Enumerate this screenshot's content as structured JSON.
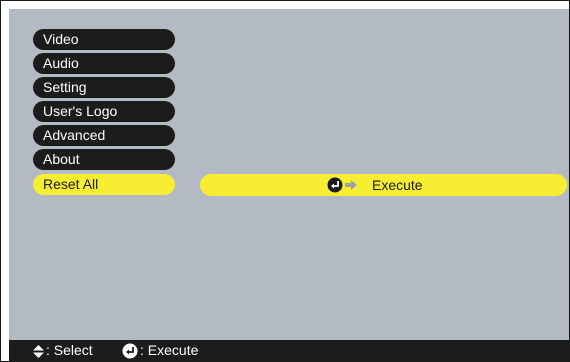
{
  "menu": {
    "items": [
      {
        "label": "Video"
      },
      {
        "label": "Audio"
      },
      {
        "label": "Setting"
      },
      {
        "label": "User's Logo"
      },
      {
        "label": "Advanced"
      },
      {
        "label": "About"
      },
      {
        "label": "Reset All",
        "selected": true
      }
    ]
  },
  "submenu": {
    "execute_label": "Execute",
    "icons": [
      "enter-icon",
      "arrow-right-icon"
    ]
  },
  "status_bar": {
    "select_label": ": Select",
    "execute_label": ": Execute",
    "icons": [
      "up-down-icon",
      "enter-icon"
    ]
  },
  "colors": {
    "background": "#b4bac4",
    "menu_item": "#1c1c1c",
    "highlight": "#f7ee34",
    "text_light": "#ffffff",
    "text_dark": "#1a1a1a"
  }
}
